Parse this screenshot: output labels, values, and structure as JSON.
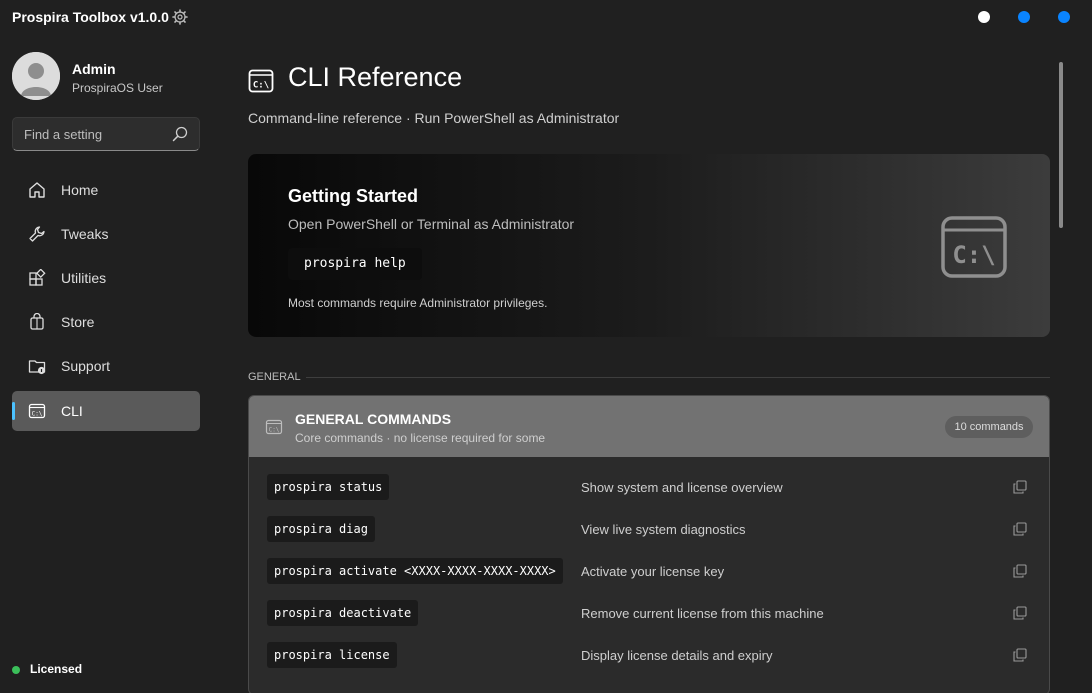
{
  "window": {
    "title": "Prospira Toolbox v1.0.0",
    "dot_colors": [
      "#ffffff",
      "#0a84ff",
      "#0a84ff"
    ]
  },
  "user": {
    "name": "Admin",
    "role": "ProspiraOS User"
  },
  "search": {
    "placeholder": "Find a setting"
  },
  "nav": {
    "items": [
      {
        "label": "Home",
        "icon": "home-icon"
      },
      {
        "label": "Tweaks",
        "icon": "wrench-icon"
      },
      {
        "label": "Utilities",
        "icon": "apps-icon"
      },
      {
        "label": "Store",
        "icon": "shopping-bag-icon"
      },
      {
        "label": "Support",
        "icon": "folder-support-icon"
      },
      {
        "label": "CLI",
        "icon": "terminal-icon",
        "active": true
      }
    ]
  },
  "status": {
    "label": "Licensed",
    "color": "#3bbf5a"
  },
  "page": {
    "title": "CLI Reference",
    "subtitle": "Command-line reference · Run PowerShell as Administrator"
  },
  "hero": {
    "title": "Getting Started",
    "subtitle": "Open PowerShell or Terminal as Administrator",
    "code": "prospira help",
    "note": "Most commands require Administrator privileges."
  },
  "section": {
    "header": "GENERAL"
  },
  "card": {
    "title": "GENERAL COMMANDS",
    "subtitle": "Core commands · no license required for some",
    "badge": "10 commands",
    "commands": [
      {
        "cmd": "prospira status",
        "desc": "Show system and license overview"
      },
      {
        "cmd": "prospira diag",
        "desc": "View live system diagnostics"
      },
      {
        "cmd": "prospira activate <XXXX-XXXX-XXXX-XXXX>",
        "desc": "Activate your license key"
      },
      {
        "cmd": "prospira deactivate",
        "desc": "Remove current license from this machine"
      },
      {
        "cmd": "prospira license",
        "desc": "Display license details and expiry"
      }
    ]
  },
  "colors": {
    "accent": "#4cc2ff",
    "background": "#202020"
  }
}
